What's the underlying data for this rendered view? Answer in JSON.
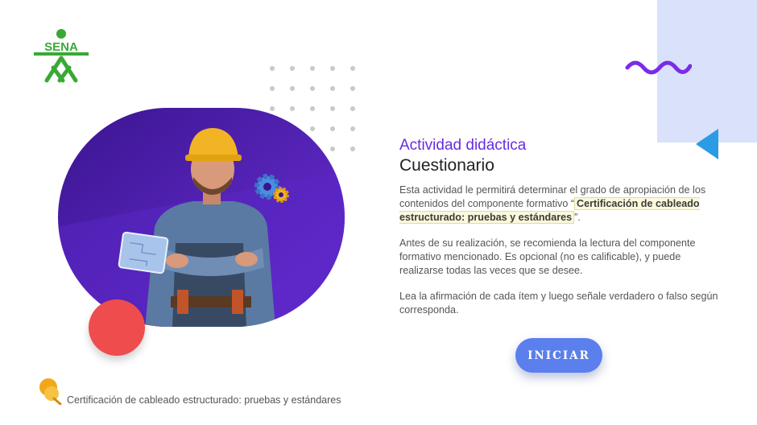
{
  "brand": {
    "logo_text": "SENA",
    "logo_color": "#39a935"
  },
  "content": {
    "activity_label": "Actividad didáctica",
    "title": "Cuestionario",
    "p1_before": "Esta actividad le permitirá determinar el grado de apropiación de los contenidos del componente formativo “",
    "p1_highlight": "Certificación de cableado estructurado: pruebas y estándares",
    "p1_after": "”.",
    "p2": "Antes de su realización, se recomienda la lectura del componente formativo mencionado.  Es opcional (no es calificable), y puede realizarse todas las veces que se desee.",
    "p3": "Lea la afirmación de cada ítem y luego señale verdadero o falso según corresponda."
  },
  "actions": {
    "start_label": "INICIAR"
  },
  "footer": {
    "component_name": "Certificación de cableado estructurado: pruebas y estándares"
  },
  "colors": {
    "accent_purple": "#6a2be0",
    "button_blue": "#5b7fec",
    "red_circle": "#ef4c4e",
    "deco_rect": "#d9e1fb",
    "triangle": "#2b9be6"
  },
  "icons": {
    "logo": "sena-logo-icon",
    "wave": "wave-decoration-icon",
    "triangle": "triangle-decoration-icon",
    "pin": "pin-icon",
    "gear": "gear-icon"
  }
}
